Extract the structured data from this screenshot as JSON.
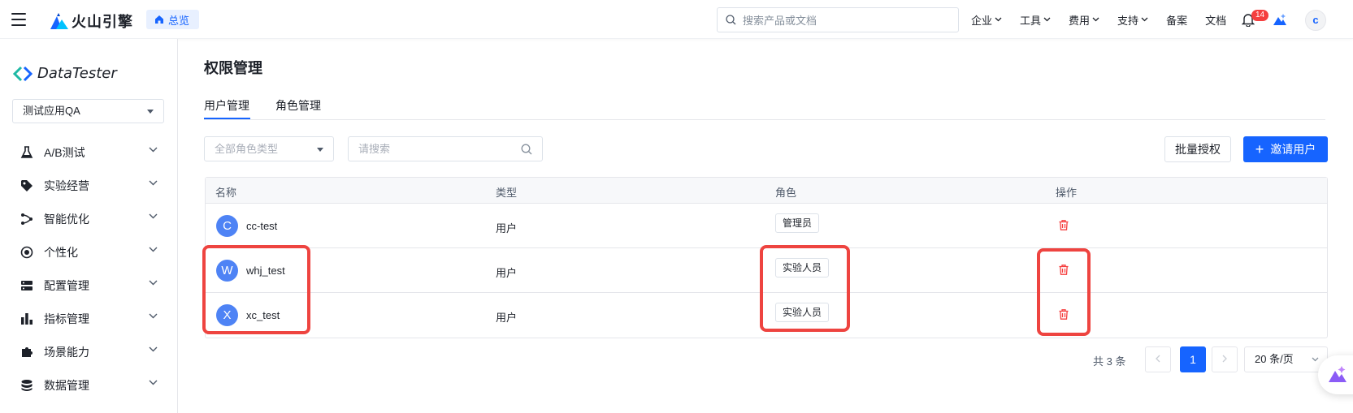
{
  "topbar": {
    "brand": "火山引擎",
    "overview": "总览",
    "search_placeholder": "搜索产品或文档",
    "nav": [
      "企业",
      "工具",
      "费用",
      "支持",
      "备案",
      "文档"
    ],
    "notification_count": "14",
    "user_initial": "c"
  },
  "sidebar": {
    "product": "DataTester",
    "app_selected": "测试应用QA",
    "items": [
      "A/B测试",
      "实验经营",
      "智能优化",
      "个性化",
      "配置管理",
      "指标管理",
      "场景能力",
      "数据管理"
    ]
  },
  "main": {
    "title": "权限管理",
    "tabs": [
      "用户管理",
      "角色管理"
    ],
    "role_filter_placeholder": "全部角色类型",
    "search_placeholder": "请搜索",
    "batch_button": "批量授权",
    "invite_button": "邀请用户",
    "columns": [
      "名称",
      "类型",
      "角色",
      "操作"
    ],
    "rows": [
      {
        "initial": "C",
        "name": "cc-test",
        "type": "用户",
        "role": "管理员"
      },
      {
        "initial": "W",
        "name": "whj_test",
        "type": "用户",
        "role": "实验人员"
      },
      {
        "initial": "X",
        "name": "xc_test",
        "type": "用户",
        "role": "实验人员"
      }
    ]
  },
  "pagination": {
    "total": "共 3 条",
    "current": "1",
    "page_size": "20 条/页"
  },
  "colors": {
    "accent": "#1664ff",
    "danger": "#f53f3f",
    "highlight": "#ee4440"
  }
}
